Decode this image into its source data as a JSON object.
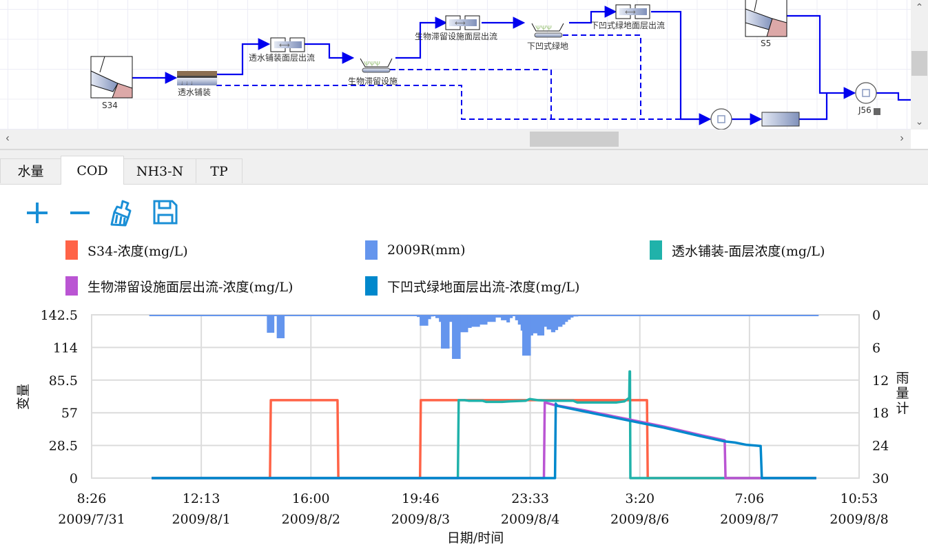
{
  "diagram": {
    "nodes": {
      "s34": "S34",
      "permeable_paving": "透水铺装",
      "paving_outflow": "透水铺装面层出流",
      "bioretention": "生物滞留设施",
      "bio_outflow": "生物滞留设施面层出流",
      "sunken_green": "下凹式绿地",
      "sunken_outflow": "下凹式绿地面层出流",
      "s5": "S5",
      "j56": "J56"
    },
    "link_color": "#0000ee"
  },
  "scrollbars": {
    "up": "⌃",
    "down": "⌄",
    "left": "‹",
    "right": "›"
  },
  "tabs": [
    {
      "label": "水量",
      "active": false
    },
    {
      "label": "COD",
      "active": true
    },
    {
      "label": "NH3-N",
      "active": false
    },
    {
      "label": "TP",
      "active": false
    }
  ],
  "toolbar": {
    "icons": [
      "zoom-in-icon",
      "zoom-out-icon",
      "clear-brush-icon",
      "save-icon"
    ],
    "accent": "#1a8fd6"
  },
  "legend": [
    {
      "label": "S34-浓度(mg/L)",
      "color": "#ff6347"
    },
    {
      "label": "2009R(mm)",
      "color": "#6495ed"
    },
    {
      "label": "透水铺装-面层浓度(mg/L)",
      "color": "#20b2aa"
    },
    {
      "label": "生物滞留设施面层出流-浓度(mg/L)",
      "color": "#ba55d3"
    },
    {
      "label": "下凹式绿地面层出流-浓度(mg/L)",
      "color": "#0088cc"
    }
  ],
  "chart_data": {
    "type": "line",
    "title": "",
    "xlabel": "日期/时间",
    "ylabel": "变量",
    "y2label": "雨量计",
    "x_unit": "hours since 2009/7/31 8:26",
    "xlim": [
      0,
      194.45
    ],
    "ylim": [
      0,
      142.5
    ],
    "y2lim": [
      30,
      0
    ],
    "grid": true,
    "x_ticks": [
      {
        "time": "8:26",
        "date": "2009/7/31"
      },
      {
        "time": "12:13",
        "date": "2009/8/1"
      },
      {
        "time": "16:00",
        "date": "2009/8/2"
      },
      {
        "time": "19:46",
        "date": "2009/8/3"
      },
      {
        "time": "23:33",
        "date": "2009/8/4"
      },
      {
        "time": "3:20",
        "date": "2009/8/6"
      },
      {
        "time": "7:06",
        "date": "2009/8/7"
      },
      {
        "time": "10:53",
        "date": "2009/8/8"
      }
    ],
    "y_ticks": [
      "0",
      "28.5",
      "57",
      "85.5",
      "114",
      "142.5"
    ],
    "y2_ticks": [
      "0",
      "6",
      "12",
      "18",
      "24",
      "30"
    ],
    "series": [
      {
        "name": "S34-浓度(mg/L)",
        "color": "#ff6347",
        "axis": "left",
        "points": [
          [
            15.2,
            0
          ],
          [
            45.2,
            0
          ],
          [
            45.4,
            68
          ],
          [
            62.3,
            68
          ],
          [
            62.5,
            0
          ],
          [
            83.2,
            0
          ],
          [
            83.4,
            68
          ],
          [
            140.7,
            68
          ],
          [
            140.9,
            0
          ],
          [
            183.6,
            0
          ]
        ]
      },
      {
        "name": "透水铺装-面层浓度(mg/L)",
        "color": "#20b2aa",
        "axis": "left",
        "points": [
          [
            15.2,
            0
          ],
          [
            92.8,
            0
          ],
          [
            93.0,
            68
          ],
          [
            94.5,
            68
          ],
          [
            95.5,
            67.5
          ],
          [
            99,
            67.5
          ],
          [
            100,
            66.5
          ],
          [
            104,
            66.5
          ],
          [
            106,
            67
          ],
          [
            110,
            67.5
          ],
          [
            111,
            69
          ],
          [
            113,
            68
          ],
          [
            116,
            67.5
          ],
          [
            122,
            67.5
          ],
          [
            123,
            66
          ],
          [
            133,
            66
          ],
          [
            135,
            67
          ],
          [
            136.2,
            70
          ],
          [
            136.3,
            93
          ],
          [
            136.4,
            93
          ],
          [
            136.5,
            0
          ],
          [
            183.6,
            0
          ]
        ]
      },
      {
        "name": "生物滞留设施面层出流-浓度(mg/L)",
        "color": "#ba55d3",
        "axis": "left",
        "points": [
          [
            15.2,
            0
          ],
          [
            114.6,
            0
          ],
          [
            114.8,
            66
          ],
          [
            117,
            64
          ],
          [
            125,
            59
          ],
          [
            135,
            52
          ],
          [
            145,
            45
          ],
          [
            155,
            37
          ],
          [
            160.4,
            33
          ],
          [
            160.6,
            0
          ],
          [
            183.6,
            0
          ]
        ]
      },
      {
        "name": "下凹式绿地面层出流-浓度(mg/L)",
        "color": "#0088cc",
        "axis": "left",
        "points": [
          [
            15.2,
            0
          ],
          [
            117.4,
            0
          ],
          [
            117.6,
            65
          ],
          [
            118,
            63
          ],
          [
            125,
            58
          ],
          [
            135,
            51
          ],
          [
            145,
            44
          ],
          [
            155,
            36
          ],
          [
            160.4,
            32
          ],
          [
            163,
            31
          ],
          [
            166,
            29
          ],
          [
            169.5,
            28
          ],
          [
            169.8,
            0
          ],
          [
            183.6,
            0
          ]
        ]
      }
    ],
    "rain": {
      "name": "2009R(mm)",
      "color": "#6495ed",
      "axis": "right",
      "span": [
        14.6,
        184.2
      ],
      "bars": [
        [
          22.1,
          23.2,
          0.2
        ],
        [
          44.4,
          46.2,
          3.3
        ],
        [
          46.9,
          48.8,
          4.3
        ],
        [
          82.4,
          83.1,
          0.4
        ],
        [
          83.1,
          85.2,
          2.0
        ],
        [
          85.2,
          85.9,
          0.8
        ],
        [
          85.9,
          86.6,
          0.3
        ],
        [
          87.1,
          88.0,
          0.6
        ],
        [
          88.0,
          88.5,
          1.3
        ],
        [
          88.5,
          90.6,
          6.2
        ],
        [
          90.6,
          91.3,
          1.3
        ],
        [
          91.3,
          93.4,
          8.1
        ],
        [
          93.4,
          95.3,
          3.2
        ],
        [
          95.3,
          96.2,
          2.4
        ],
        [
          96.2,
          98.3,
          2.2
        ],
        [
          98.3,
          100.2,
          1.8
        ],
        [
          100.2,
          102.3,
          1.3
        ],
        [
          102.3,
          103.7,
          0.5
        ],
        [
          103.7,
          105.1,
          1.0
        ],
        [
          105.1,
          105.9,
          1.4
        ],
        [
          105.9,
          106.6,
          0.6
        ],
        [
          107.3,
          108.0,
          1.0
        ],
        [
          108.0,
          108.7,
          1.8
        ],
        [
          108.7,
          109.1,
          2.9
        ],
        [
          109.1,
          111.2,
          7.5
        ],
        [
          111.2,
          111.8,
          3.8
        ],
        [
          111.8,
          112.9,
          3.4
        ],
        [
          112.9,
          114.6,
          3.8
        ],
        [
          114.6,
          115.3,
          2.2
        ],
        [
          115.3,
          116.4,
          2.7
        ],
        [
          116.4,
          117.4,
          3.2
        ],
        [
          117.4,
          118.1,
          2.8
        ],
        [
          118.1,
          119.2,
          2.2
        ],
        [
          119.2,
          119.9,
          1.8
        ],
        [
          119.9,
          120.6,
          1.3
        ],
        [
          120.6,
          121.3,
          0.9
        ],
        [
          121.3,
          122.0,
          0.5
        ],
        [
          122.0,
          123.2,
          0.3
        ]
      ]
    }
  }
}
